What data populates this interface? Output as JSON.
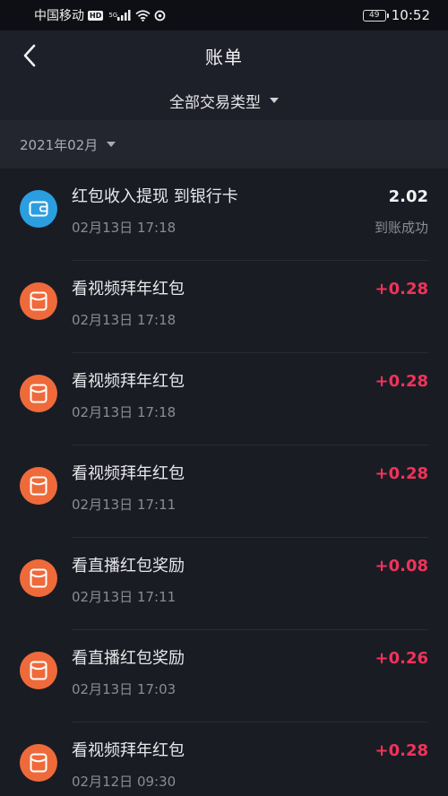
{
  "status_bar": {
    "carrier": "中国移动",
    "hd_badge": "HD",
    "network": "5G",
    "battery": "49",
    "time": "10:52"
  },
  "header": {
    "title": "账单",
    "back_icon": "chevron-left-icon"
  },
  "filter": {
    "label": "全部交易类型"
  },
  "month": {
    "label": "2021年02月"
  },
  "transactions": [
    {
      "icon": "wallet-icon",
      "icon_color": "#2b9ee0",
      "title": "红包收入提现 到银行卡",
      "time": "02月13日 17:18",
      "amount": "2.02",
      "status": "到账成功"
    },
    {
      "icon": "redpacket-icon",
      "icon_color": "#ef6a3a",
      "title": "看视频拜年红包",
      "time": "02月13日 17:18",
      "amount": "+0.28",
      "status": ""
    },
    {
      "icon": "redpacket-icon",
      "icon_color": "#ef6a3a",
      "title": "看视频拜年红包",
      "time": "02月13日 17:18",
      "amount": "+0.28",
      "status": ""
    },
    {
      "icon": "redpacket-icon",
      "icon_color": "#ef6a3a",
      "title": "看视频拜年红包",
      "time": "02月13日 17:11",
      "amount": "+0.28",
      "status": ""
    },
    {
      "icon": "redpacket-icon",
      "icon_color": "#ef6a3a",
      "title": "看直播红包奖励",
      "time": "02月13日 17:11",
      "amount": "+0.08",
      "status": ""
    },
    {
      "icon": "redpacket-icon",
      "icon_color": "#ef6a3a",
      "title": "看直播红包奖励",
      "time": "02月13日 17:03",
      "amount": "+0.26",
      "status": ""
    },
    {
      "icon": "redpacket-icon",
      "icon_color": "#ef6a3a",
      "title": "看视频拜年红包",
      "time": "02月12日 09:30",
      "amount": "+0.28",
      "status": ""
    }
  ],
  "colors": {
    "positive_amount": "#f0335a",
    "background": "#1a1c24"
  }
}
